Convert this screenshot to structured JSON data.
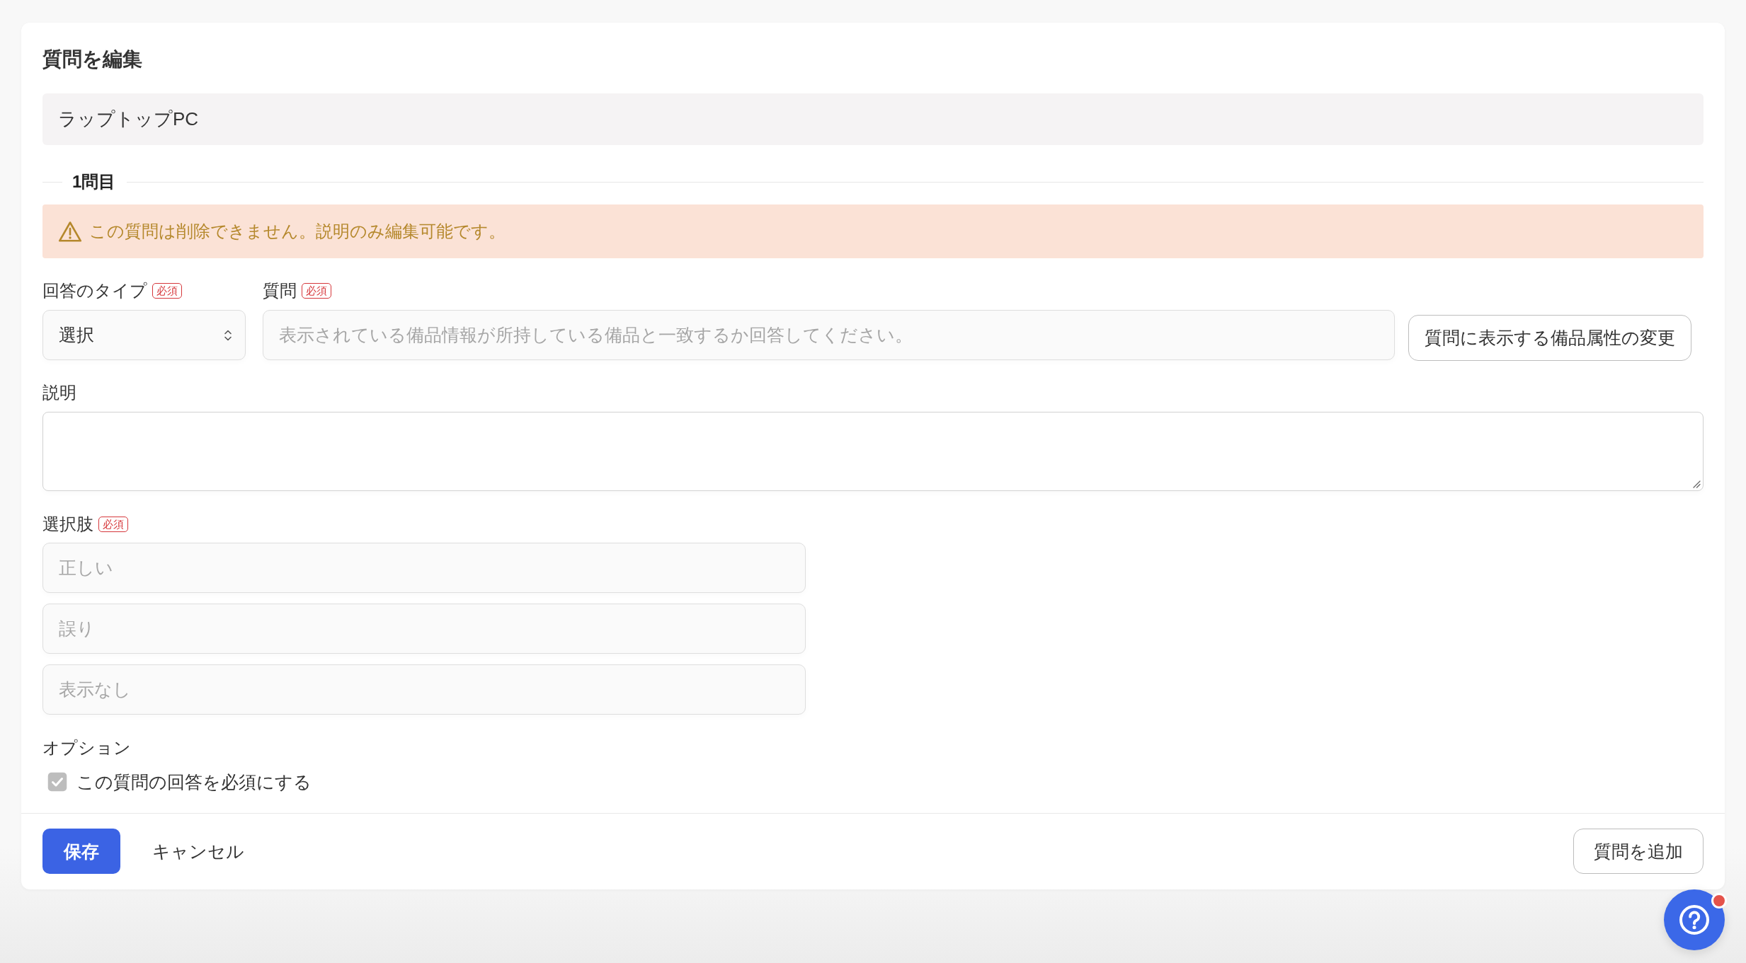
{
  "form": {
    "title": "質問を編集",
    "name_field": {
      "value": "ラップトップPC"
    }
  },
  "question_section": {
    "heading": "1問目"
  },
  "warning": {
    "text": "この質問は削除できません。説明のみ編集可能です。"
  },
  "answer_type": {
    "label": "回答のタイプ",
    "badge": "必須",
    "value": "選択"
  },
  "question": {
    "label": "質問",
    "badge": "必須",
    "value": "表示されている備品情報が所持している備品と一致するか回答してください。",
    "disabled": true
  },
  "attributes_button": {
    "label": "質問に表示する備品属性の変更"
  },
  "description": {
    "label": "説明"
  },
  "choices": {
    "label": "選択肢",
    "badge": "必須",
    "items": [
      {
        "value": "正しい",
        "disabled": true
      },
      {
        "value": "誤り",
        "disabled": true
      },
      {
        "value": "表示なし",
        "disabled": true
      }
    ]
  },
  "options": {
    "label": "オプション",
    "items": [
      {
        "label": "この質問の回答を必須にする",
        "checked": true,
        "disabled": true
      }
    ]
  },
  "footer": {
    "buttons": [
      {
        "label": "保存",
        "kind": "primary"
      },
      {
        "label": "キャンセル",
        "kind": "text"
      },
      {
        "label": "質問を追加",
        "kind": "outline"
      }
    ]
  },
  "help_button": {
    "notification": true
  }
}
